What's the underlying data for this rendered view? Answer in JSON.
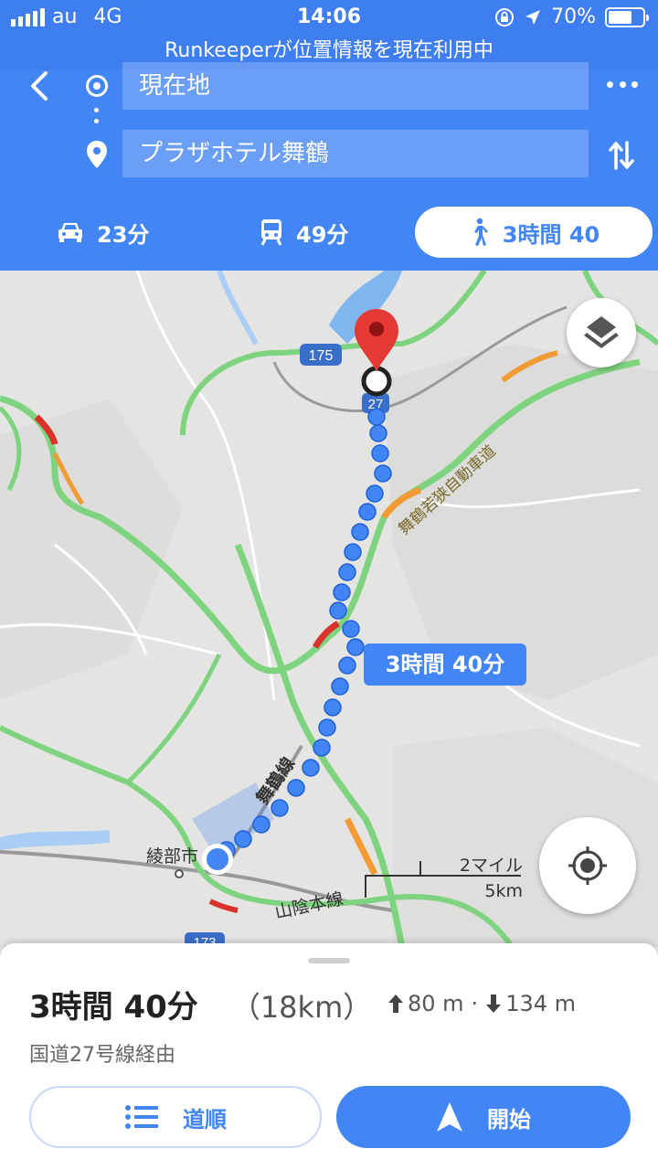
{
  "status_bar": {
    "carrier": "au",
    "network": "4G",
    "time": "14:06",
    "battery": "70%",
    "battery_level": 0.7
  },
  "banner": "Runkeeperが位置情報を現在利用中",
  "directions": {
    "from": "現在地",
    "to": "プラザホテル舞鶴",
    "modes": [
      {
        "name": "car",
        "label": "23分"
      },
      {
        "name": "transit",
        "label": "49分"
      },
      {
        "name": "walk",
        "label": "3時間 40",
        "selected": true
      }
    ]
  },
  "map": {
    "route_label": "3時間 40分",
    "place_labels": {
      "ayabe": "綾部市",
      "maizuru_line": "舞鶴線",
      "sanin_line": "山陰本線",
      "expressway": "舞鶴若狭自動車道"
    },
    "route_shields": [
      "175",
      "27",
      "173"
    ],
    "scale": {
      "imperial": "2マイル",
      "metric": "5km"
    }
  },
  "sheet": {
    "duration": "3時間 40分",
    "distance": "（18km）",
    "ascent": "80 m",
    "separator": "·",
    "descent": "134 m",
    "via": "国道27号線経由",
    "steps_label": "道順",
    "start_label": "開始"
  },
  "colors": {
    "primary": "#4285f4",
    "status_bar": "#3f7ef0",
    "traffic_green": "#7ed47e",
    "traffic_orange": "#f29b35",
    "traffic_red": "#d9322b",
    "pin_red": "#e53935"
  }
}
